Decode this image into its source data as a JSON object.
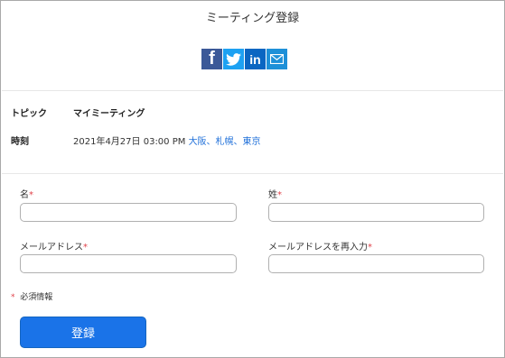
{
  "header": {
    "title": "ミーティング登録"
  },
  "share": [
    {
      "name": "facebook-icon",
      "glyph": "f",
      "color": "#3b5998"
    },
    {
      "name": "twitter-icon",
      "glyph": "twitter",
      "color": "#1da1f2"
    },
    {
      "name": "linkedin-icon",
      "glyph": "in",
      "color": "#0a66c2"
    },
    {
      "name": "email-icon",
      "glyph": "envelope",
      "color": "#1e90d8"
    }
  ],
  "info": {
    "topic_label": "トピック",
    "topic_value": "マイミーティング",
    "time_label": "時刻",
    "time_value": "2021年4月27日 03:00 PM ",
    "timezone": "大阪、札幌、東京"
  },
  "form": {
    "first_name_label": "名",
    "last_name_label": "姓",
    "email_label": "メールアドレス",
    "email_confirm_label": "メールアドレスを再入力",
    "required_mark": "*",
    "first_name_value": "",
    "last_name_value": "",
    "email_value": "",
    "email_confirm_value": ""
  },
  "required_note": {
    "mark": "*",
    "text": "必須情報"
  },
  "submit_label": "登録",
  "colors": {
    "accent": "#1a73e8",
    "required": "#e0424a",
    "link": "#1e6fd9"
  }
}
